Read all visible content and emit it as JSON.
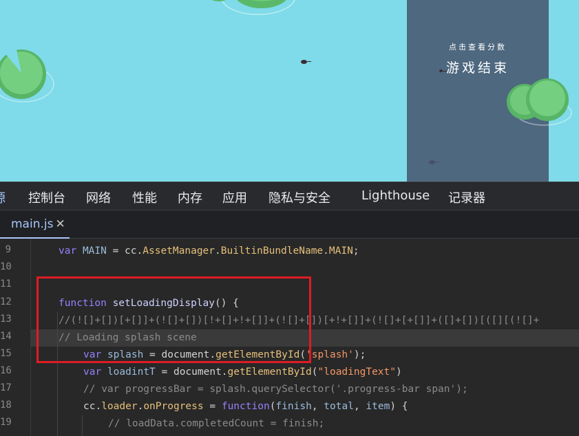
{
  "game": {
    "panel_hint": "点击查看分数",
    "panel_title": "游戏结束"
  },
  "devtools": {
    "tabs": [
      "源",
      "控制台",
      "网络",
      "性能",
      "内存",
      "应用",
      "隐私与安全",
      "Lighthouse",
      "记录器"
    ],
    "file_tab": "main.js",
    "file_tab_close": "✕"
  },
  "code": {
    "line_numbers": [
      "9",
      "10",
      "11",
      "12",
      "13",
      "14",
      "15",
      "16",
      "17",
      "18",
      "19"
    ],
    "lines": [
      "var MAIN = cc.AssetManager.BuiltinBundleName.MAIN;",
      "",
      "",
      "function setLoadingDisplay() {",
      "    //(![]+[])[+[]]+(![]+[])[!+[]+!+[]]+(![]+[])[+!+[]]+(![]+[+[]]+([]+[])[([][(![]+",
      "    // Loading splash scene",
      "    var splash = document.getElementById('splash');",
      "    var loadintT = document.getElementById(\"loadingText\")",
      "    // var progressBar = splash.querySelector('.progress-bar span');",
      "    cc.loader.onProgress = function(finish, total, item) {",
      "        // loadData.completedCount = finish;"
    ]
  },
  "colors": {
    "water": "#7fdbe9",
    "panel": "#485870",
    "highlight_box": "#e01b24",
    "keyword": "#9980ff",
    "string": "#f29766",
    "comment": "#8b8b8b"
  }
}
